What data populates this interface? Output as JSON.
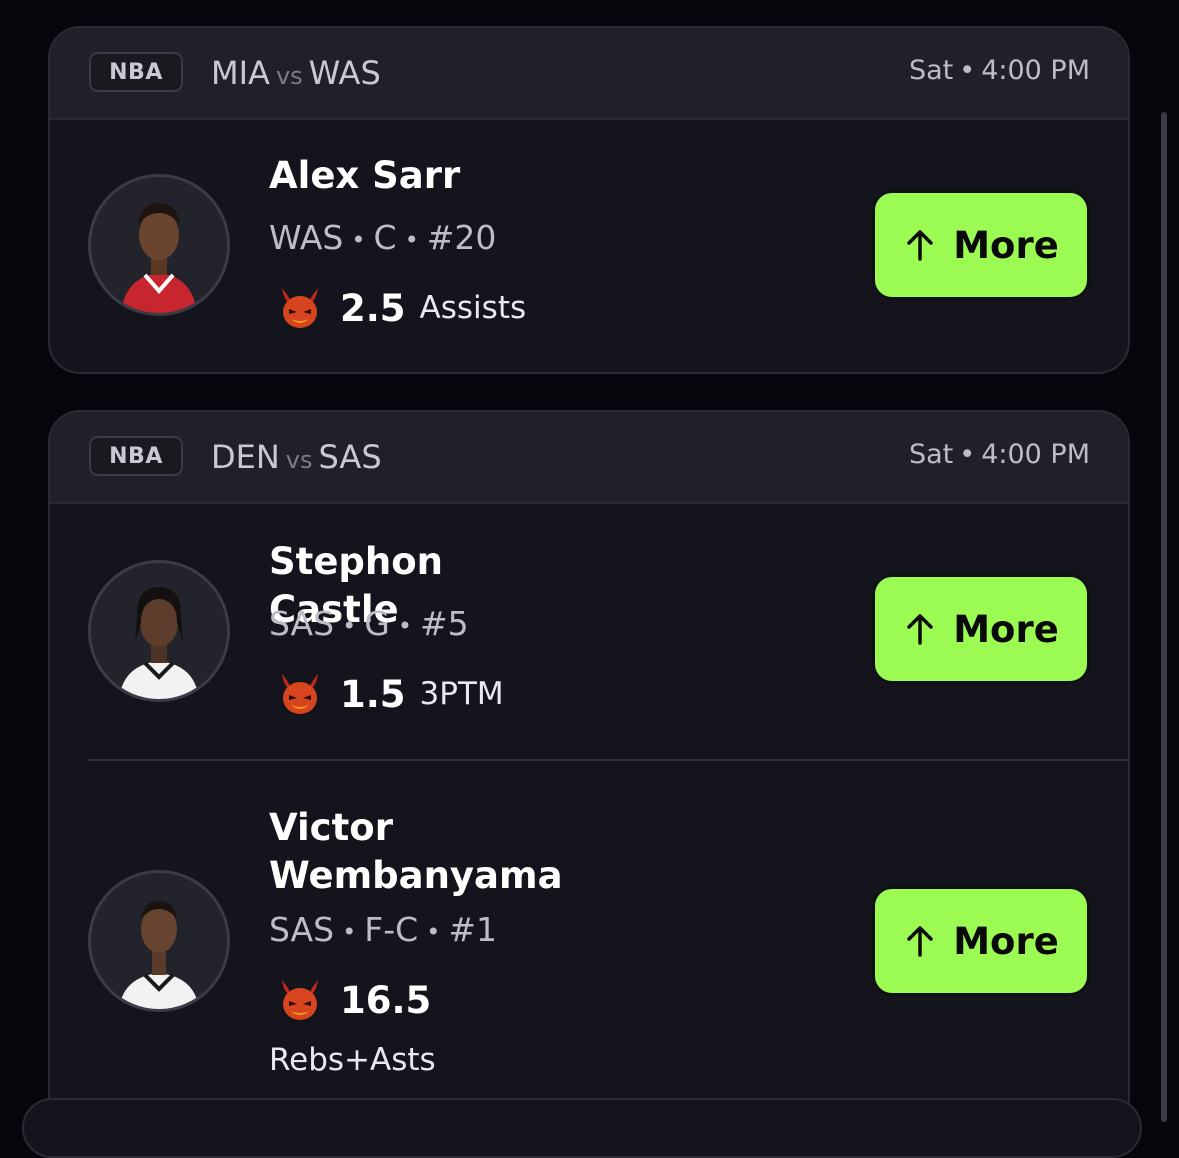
{
  "games": [
    {
      "league": "NBA",
      "home": "MIA",
      "vs": "vs",
      "away": "WAS",
      "day": "Sat",
      "time": "4:00 PM",
      "players": [
        {
          "name": "Alex Sarr",
          "team": "WAS",
          "position": "C",
          "number": "#20",
          "line": "2.5",
          "stat": "Assists",
          "button": "More",
          "jersey_color": "#c8262f"
        }
      ]
    },
    {
      "league": "NBA",
      "home": "DEN",
      "vs": "vs",
      "away": "SAS",
      "day": "Sat",
      "time": "4:00 PM",
      "players": [
        {
          "name": "Stephon Castle",
          "team": "SAS",
          "position": "G",
          "number": "#5",
          "line": "1.5",
          "stat": "3PTM",
          "button": "More",
          "jersey_color": "#f2f2f2"
        },
        {
          "name": "Victor Wembanyama",
          "team": "SAS",
          "position": "F-C",
          "number": "#1",
          "line": "16.5",
          "stat": "Rebs+Asts",
          "button": "More",
          "jersey_color": "#f2f2f2"
        }
      ]
    }
  ],
  "separator": "•",
  "colors": {
    "accent": "#9bfb52",
    "card": "#14141c",
    "header": "#202029",
    "background": "#06060c"
  },
  "icons": {
    "prop_icon": "demon-icon",
    "button_icon": "arrow-up-icon"
  }
}
